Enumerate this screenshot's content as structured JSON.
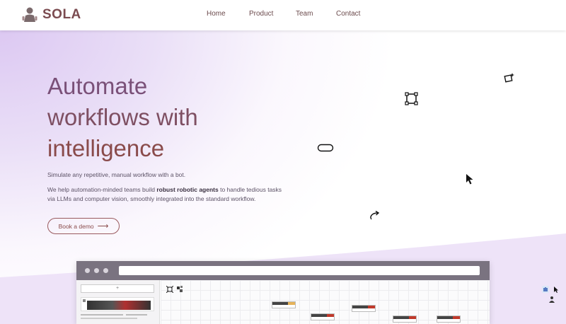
{
  "brand": {
    "name": "SOLA",
    "logo_icon": "robot-logo-icon",
    "color": "#7b4b50"
  },
  "nav": {
    "items": [
      "Home",
      "Product",
      "Team",
      "Contact"
    ]
  },
  "hero": {
    "headline": [
      "Automate",
      "workflows with",
      "intelligence"
    ],
    "subtitle": "Simulate any repetitive, manual workflow with a bot.",
    "description_before": "We help automation-minded teams build ",
    "description_bold": "robust robotic agents",
    "description_after": " to handle tedious tasks via LLMs and computer vision, smoothly integrated into the standard workflow.",
    "cta_label": "Book a demo",
    "cta_icon": "arrow-right-icon"
  },
  "floating_icons": [
    "sparkle-select-icon",
    "bounding-box-icon",
    "pill-shape-icon",
    "cursor-arrow-icon",
    "curved-arrow-icon"
  ],
  "mockup": {
    "side_input_placeholder": "+",
    "toolbar_icons": [
      "select-icon",
      "group-icon"
    ],
    "right_icons": [
      "hand-icon",
      "pointer-click-icon",
      "user-icon"
    ]
  },
  "colors": {
    "accent": "#8a4b4b",
    "headline_purple": "#7a5078",
    "background_lavender": "#e5d5f5"
  }
}
